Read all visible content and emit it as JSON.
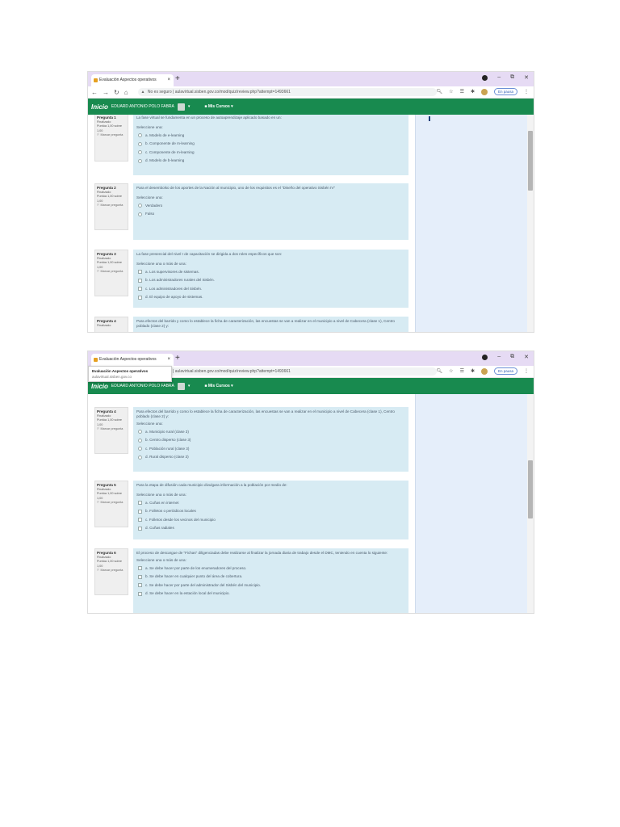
{
  "browser": {
    "tab_title": "Evaluación Aspectos operativos",
    "tab_close": "×",
    "new_tab": "+",
    "insecure_label": "No es seguro",
    "url": "aulavirtual.sisben.gov.co/mod/quiz/review.php?attempt=1493661",
    "paused_label": "En pausa"
  },
  "tooltip": {
    "title": "Evaluación Aspectos operativos",
    "domain": "aulavirtual.sisben.gov.co"
  },
  "appbar": {
    "logo": "Inicio",
    "user": "EDUARD ANTONIO POLO FABRA",
    "courses": "Mis Cursos"
  },
  "questions": [
    {
      "label": "Pregunta 1",
      "status": "Finalizado",
      "score": "Puntúa 1,00 sobre 1,00",
      "flag": "Marcar pregunta",
      "text": "La fase virtual se fundamenta en un proceso de autoaprendizaje aplicado basado en un:",
      "prompt": "Seleccione una:",
      "options": [
        "a. Modelo de e-learning",
        "b. Componente de m-learning",
        "c. Componente de m-learning",
        "d. Modelo de b-learning"
      ]
    },
    {
      "label": "Pregunta 2",
      "status": "Finalizado",
      "score": "Puntúa 1,00 sobre 1,00",
      "flag": "Marcar pregunta",
      "text": "Para el desembolso de los aportes de la Nación al municipio, uno de los requisitos es el \"Diseño del operativo Sisbén IV\"",
      "prompt": "Seleccione una:",
      "options": [
        "Verdadero",
        "Falso"
      ]
    },
    {
      "label": "Pregunta 3",
      "status": "Finalizado",
      "score": "Puntúa 1,00 sobre 1,00",
      "flag": "Marcar pregunta",
      "text": "La fase presencial del nivel I de capacitación se dirigida a dos roles específicos que son:",
      "prompt": "Seleccione una o más de una:",
      "options": [
        "a. Los supervisores de sistemas.",
        "b. Los administradores rurales del Sisbén.",
        "c. Los administradores del Sisbén.",
        "d. El equipo de apoyo de sistemas."
      ]
    },
    {
      "label": "Pregunta 4",
      "status": "Finalizado",
      "score": "Puntúa 1,00 sobre 1,00",
      "flag": "Marcar pregunta",
      "text": "Para efectos del barrido y como lo establece la ficha de caracterización, las encuestas se van a realizar en el municipio a nivel de Cabecera (clase 1), Centro poblado (clase 2) y:",
      "prompt": "Seleccione una:",
      "options": [
        "a. Municipio rural (clase 3)",
        "b. Centro disperso (clase 3)",
        "c. Población rural (clase 3)",
        "d. Rural disperso (clase 3)"
      ]
    },
    {
      "label": "Pregunta 5",
      "status": "Finalizado",
      "score": "Puntúa 1,00 sobre 1,00",
      "flag": "Marcar pregunta",
      "text": "Para la etapa de difusión cada municipio divulgara información a la población por medio de:",
      "prompt": "Seleccione una o más de una:",
      "options": [
        "a. Cuñas en internet",
        "b. Folletos o periódicos locales",
        "c. Folletos desde los vecinos del municipio",
        "d. Cuñas radiales"
      ]
    },
    {
      "label": "Pregunta 6",
      "status": "Finalizado",
      "score": "Puntúa 1,00 sobre 1,00",
      "flag": "Marcar pregunta",
      "text": "El proceso de descargue de \"Fichas\" diligenciadas debe realizarse al finalizar la jornada diaria de trabajo desde el DMC, teniendo en cuenta lo siguiente:",
      "prompt": "Seleccione una o más de una:",
      "options": [
        "a. Se debe hacer por parte de los enumeradores del proceso.",
        "b. Se debe hacer en cualquier punto del área de cobertura.",
        "c. Se debe hacer por parte del administrador del Sisbén del municipio.",
        "d. Se debe hacer en la estación local del municipio."
      ]
    }
  ]
}
